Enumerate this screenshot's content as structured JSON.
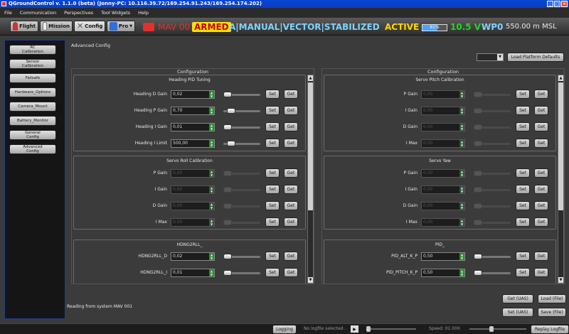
{
  "window": {
    "title": "QGroundControl v. 1.1.0 (beta) (Jonny-PC: 10.116.39.72/169.254.91.243/169.254.174.202)",
    "min": "_",
    "max": "□",
    "close": "×"
  },
  "menu": [
    "File",
    "Communication",
    "Perspectives",
    "Tool Widgets",
    "Help"
  ],
  "toolbar": {
    "buttons": [
      {
        "label": "Flight",
        "icon": "shield-icon"
      },
      {
        "label": "Mission",
        "icon": "map-icon"
      },
      {
        "label": "Config",
        "icon": "wrench-icon"
      },
      {
        "label": "Pro",
        "icon": "plot-icon"
      }
    ],
    "mav_name": "MAV 001",
    "armed": "ARMED",
    "mode": "A|MANUAL|VECTOR|STABILIZED",
    "state": "ACTIVE",
    "battery_percent": 61,
    "battery_label": "61%",
    "voltage": "10.5 V",
    "waypoint": "WP0",
    "altitude": "550.00 m MSL",
    "colors": {
      "armed_bg": "#ffe100",
      "armed_fg": "#c00000",
      "mode": "#7fd3ff",
      "state": "#ffd500",
      "voltage": "#27d327",
      "mav": "#e03030"
    }
  },
  "sidebar": [
    {
      "label": "RC\nCalibration"
    },
    {
      "label": "Sensor\nCalibration"
    },
    {
      "label": "Failsafe"
    },
    {
      "label": "Hardware_Options"
    },
    {
      "label": "Camera_Mount"
    },
    {
      "label": "Battery_Monitor"
    },
    {
      "label": "General\nConfig"
    },
    {
      "label": "Advanced\nConfig"
    }
  ],
  "main": {
    "title": "Advanced Config",
    "load_platform_defaults": "Load Platform Defaults",
    "left_column": {
      "title": "Configuration",
      "groups": [
        {
          "title": "Heading PID Tuning",
          "enabled": true,
          "params": [
            {
              "label": "Heading D Gain",
              "value": "0,02",
              "level": 0.0
            },
            {
              "label": "Heading P Gain",
              "value": "0,70",
              "level": 0.12
            },
            {
              "label": "Heading I Gain",
              "value": "0,01",
              "level": 0.0
            },
            {
              "label": "Heading I Limit",
              "value": "500,00",
              "level": 0.12
            }
          ]
        },
        {
          "title": "Servo Roll Calibration",
          "enabled": false,
          "params": [
            {
              "label": "P Gain",
              "value": "0,00",
              "level": 0.0
            },
            {
              "label": "I Gain",
              "value": "0,00",
              "level": 0.0
            },
            {
              "label": "D Gain",
              "value": "0,00",
              "level": 0.0
            },
            {
              "label": "I Max",
              "value": "0,00",
              "level": 0.0
            }
          ]
        },
        {
          "title": "HDNG2RLL_",
          "enabled": true,
          "params": [
            {
              "label": "HDNG2RLL_D",
              "value": "0,02",
              "level": 0.0
            },
            {
              "label": "HDNG2RLL_I",
              "value": "0,01",
              "level": 0.0
            }
          ]
        }
      ]
    },
    "right_column": {
      "title": "Configuration",
      "groups": [
        {
          "title": "Servo Pitch Calibration",
          "enabled": false,
          "params": [
            {
              "label": "P Gain",
              "value": "0,00",
              "level": 0.0
            },
            {
              "label": "I Gain",
              "value": "0,00",
              "level": 0.0
            },
            {
              "label": "D Gain",
              "value": "0,00",
              "level": 0.0
            },
            {
              "label": "I Max",
              "value": "0,00",
              "level": 0.0
            }
          ]
        },
        {
          "title": "Servo Yaw",
          "enabled": false,
          "params": [
            {
              "label": "P Gain",
              "value": "0,00",
              "level": 0.0
            },
            {
              "label": "I Gain",
              "value": "0,00",
              "level": 0.0
            },
            {
              "label": "D Gain",
              "value": "0,00",
              "level": 0.0
            },
            {
              "label": "I Max",
              "value": "0,00",
              "level": 0.0
            }
          ]
        },
        {
          "title": "PID_",
          "enabled": true,
          "params": [
            {
              "label": "PID_ALT_K_P",
              "value": "0,50",
              "level": 0.0
            },
            {
              "label": "PID_PITCH_K_P",
              "value": "0,50",
              "level": 0.0
            }
          ]
        }
      ]
    },
    "set_label": "Set",
    "get_label": "Get",
    "get_uas": "Get (UAS)",
    "load_file": "Load (File)",
    "set_uas": "Set (UAS)",
    "save_file": "Save (File)",
    "status": "Reading from system MAV 001"
  },
  "bottom": {
    "logging": "Logging",
    "logfile": "No logfile selected..",
    "play": "▶",
    "speed": "Speed: 01.00X",
    "replay": "Replay Logfile"
  }
}
